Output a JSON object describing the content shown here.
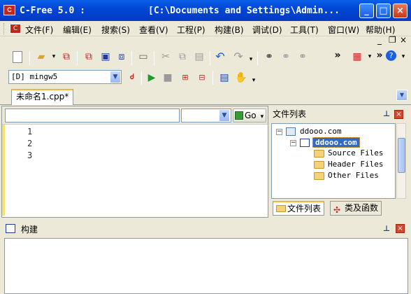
{
  "window": {
    "title_app": "C-Free 5.0 :",
    "title_path": "[C:\\Documents and Settings\\Admin...",
    "app_icon_text": "C",
    "controls": {
      "minimize": "_",
      "maximize": "□",
      "close": "×"
    }
  },
  "menubar": {
    "items": [
      "文件(F)",
      "编辑(E)",
      "搜索(S)",
      "查看(V)",
      "工程(P)",
      "构建(B)",
      "调试(D)",
      "工具(T)",
      "窗口(W)",
      "帮助(H)"
    ],
    "mdi_controls": [
      "_",
      "❐",
      "×"
    ]
  },
  "toolbar": {
    "overflow": "»",
    "compiler_select": "[D] mingw5"
  },
  "tabs": {
    "active": "未命名1.cpp*"
  },
  "function_bar": {
    "go_label": "Go"
  },
  "editor": {
    "line_numbers": [
      "1",
      "2",
      "3"
    ]
  },
  "file_panel": {
    "title": "文件列表",
    "tree": {
      "root": "ddooo.com",
      "project": "ddooo.com",
      "folders": [
        "Source Files",
        "Header Files",
        "Other Files"
      ]
    },
    "tabs": [
      "文件列表",
      "类及函数"
    ]
  },
  "build_panel": {
    "title": "构建"
  },
  "colors": {
    "titlebar": "#0046d5",
    "selection": "#316ac5",
    "tab_highlight": "#f5b43b",
    "close_red": "#d8452a"
  }
}
